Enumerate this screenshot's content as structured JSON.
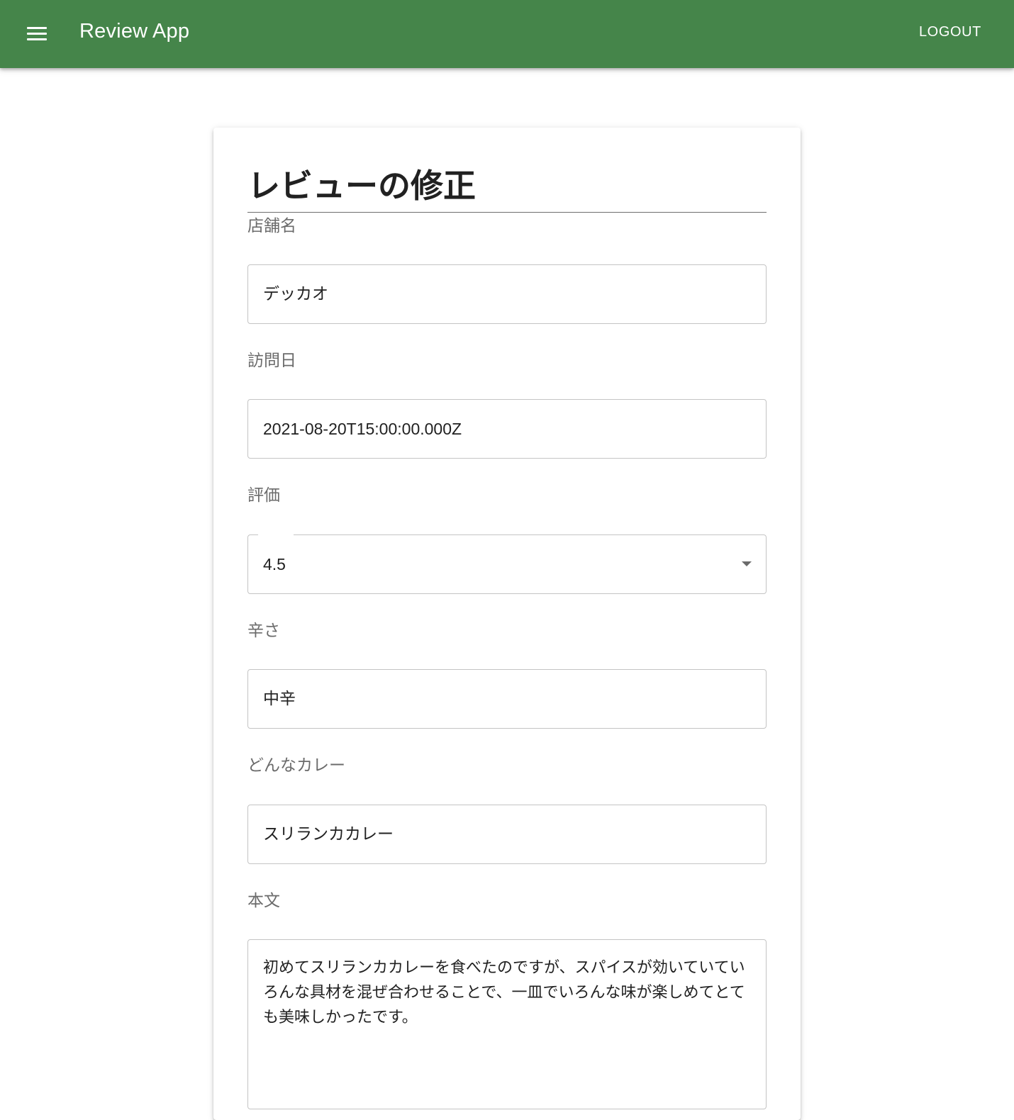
{
  "appbar": {
    "title": "Review App",
    "logout_label": "LOGOUT",
    "menu_icon": "menu-icon",
    "color": "#45854a"
  },
  "form": {
    "heading": "レビューの修正",
    "shop_name": {
      "label": "店舗名",
      "value": "デッカオ"
    },
    "visit_date": {
      "label": "訪問日",
      "value": "2021-08-20T15:00:00.000Z"
    },
    "rating": {
      "label": "評価",
      "value": "4.5",
      "icon": "chevron-down-icon"
    },
    "spiciness": {
      "label": "辛さ",
      "value": "中辛"
    },
    "curry_type": {
      "label": "どんなカレー",
      "value": "スリランカカレー"
    },
    "body": {
      "label": "本文",
      "value": "初めてスリランカカレーを食べたのですが、スパイスが効いていていろんな具材を混ぜ合わせることで、一皿でいろんな味が楽しめてとても美味しかったです。"
    }
  }
}
